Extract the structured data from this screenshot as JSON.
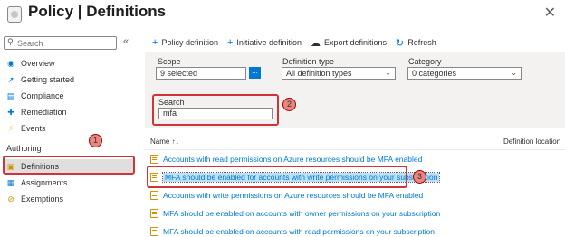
{
  "header": {
    "title": "Policy | Definitions",
    "more": "···",
    "close": "✕"
  },
  "sidebar": {
    "search_placeholder": "Search",
    "items_top": [
      {
        "label": "Overview",
        "icon": "overview-icon"
      },
      {
        "label": "Getting started",
        "icon": "rocket-icon"
      },
      {
        "label": "Compliance",
        "icon": "compliance-icon"
      },
      {
        "label": "Remediation",
        "icon": "remediation-icon"
      },
      {
        "label": "Events",
        "icon": "lightning-icon"
      }
    ],
    "section_authoring": "Authoring",
    "items_authoring": [
      {
        "label": "Definitions",
        "icon": "definitions-icon"
      },
      {
        "label": "Assignments",
        "icon": "assignments-icon"
      },
      {
        "label": "Exemptions",
        "icon": "exemptions-icon"
      }
    ]
  },
  "toolbar": {
    "policy_definition": "Policy definition",
    "initiative_definition": "Initiative definition",
    "export_definitions": "Export definitions",
    "refresh": "Refresh"
  },
  "filters": {
    "scope_label": "Scope",
    "scope_value": "9 selected",
    "scope_button": "...",
    "definition_type_label": "Definition type",
    "definition_type_value": "All definition types",
    "category_label": "Category",
    "category_value": "0 categories",
    "search_label": "Search",
    "search_value": "mfa"
  },
  "table": {
    "col_name": "Name ↑↓",
    "col_location": "Definition location",
    "rows": [
      {
        "name": "Accounts with read permissions on Azure resources should be MFA enabled"
      },
      {
        "name": "MFA should be enabled for accounts with write permissions on your subscription"
      },
      {
        "name": "Accounts with write permissions on Azure resources should be MFA enabled"
      },
      {
        "name": "MFA should be enabled on accounts with owner permissions on your subscription"
      },
      {
        "name": "MFA should be enabled on accounts with read permissions on your subscription"
      }
    ]
  },
  "callouts": {
    "one": "1",
    "two": "2",
    "three": "3"
  },
  "colors": {
    "accent": "#0078d4",
    "callout_border": "#d13438",
    "callout_fill": "#e8877f",
    "selected_row": "#bde0f7"
  }
}
